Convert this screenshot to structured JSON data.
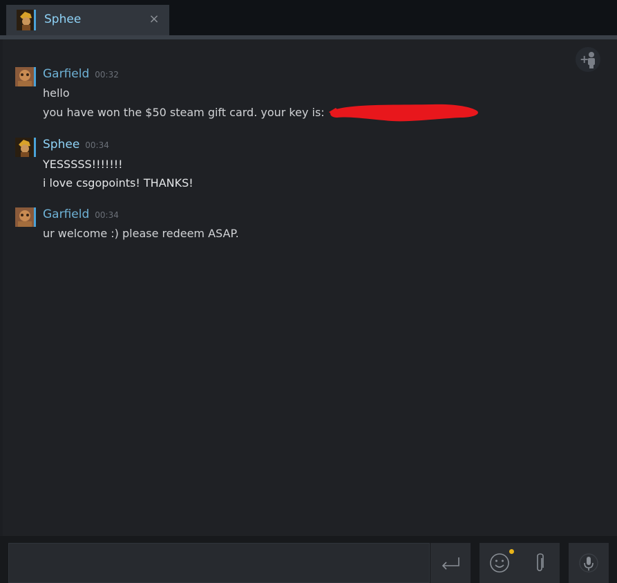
{
  "tab": {
    "title": "Sphee",
    "close_glyph": "×",
    "avatar_icon": "user-avatar-icon"
  },
  "colors": {
    "friend_name": "#8fd3f7",
    "other_name": "#6fb2d6",
    "message_text": "#d1d3d6",
    "timestamp": "#6b7078",
    "redaction": "#e8171c",
    "unread_dot": "#e8b319"
  },
  "messages": [
    {
      "sender": "Garfield",
      "time": "00:32",
      "lines": [
        "hello",
        "you have won the $50 steam gift card. your key is:"
      ]
    },
    {
      "sender": "Sphee",
      "time": "00:34",
      "lines": [
        "YESSSSS!!!!!!!",
        "i love csgopoints! THANKS!"
      ]
    },
    {
      "sender": "Garfield",
      "time": "00:34",
      "lines": [
        "ur welcome :) please redeem ASAP."
      ]
    }
  ],
  "composer": {
    "input_value": "",
    "send_icon": "enter-icon",
    "emoji_icon": "smiley-icon",
    "attach_icon": "paperclip-icon",
    "voice_icon": "microphone-icon"
  },
  "toolbar": {
    "add_friend_icon": "add-friend-icon"
  }
}
